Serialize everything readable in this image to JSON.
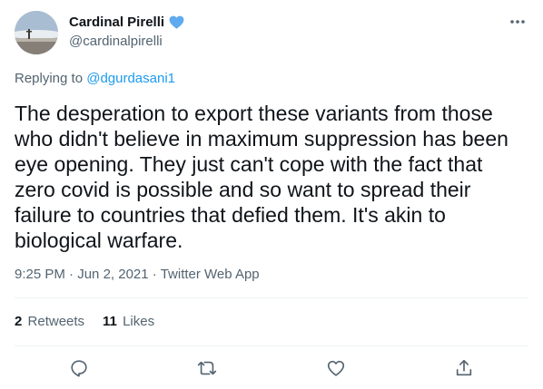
{
  "author": {
    "display_name": "Cardinal Pirelli",
    "handle": "@cardinalpirelli",
    "badge_icon": "blue-heart-icon",
    "badge_color": "#5eaaf0"
  },
  "reply": {
    "prefix": "Replying to",
    "mention": "@dgurdasani1"
  },
  "tweet": {
    "text": "The desperation to export these variants from those who didn't believe in maximum suppression has been eye opening. They just can't cope with the fact that zero covid is possible and so want to spread their failure to countries that defied them. It's akin to biological warfare.",
    "time": "9:25 PM",
    "date": "Jun 2, 2021",
    "source": "Twitter Web App",
    "separator": " · "
  },
  "stats": {
    "retweets_count": "2",
    "retweets_label": "Retweets",
    "likes_count": "11",
    "likes_label": "Likes"
  },
  "actions": {
    "reply_icon": "reply-icon",
    "retweet_icon": "retweet-icon",
    "like_icon": "heart-icon",
    "share_icon": "share-icon",
    "more_icon": "more-icon"
  },
  "colors": {
    "accent": "#1d9bf0",
    "text_primary": "#0f1419",
    "text_secondary": "#536471",
    "divider": "#eff3f4"
  }
}
